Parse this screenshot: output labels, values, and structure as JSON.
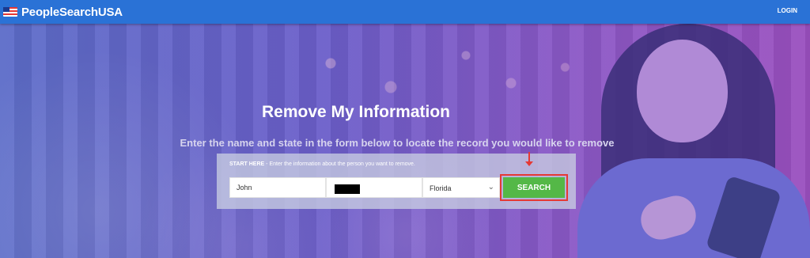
{
  "header": {
    "brand_name": "PeopleSearchUSA",
    "login_label": "LOGIN"
  },
  "hero": {
    "title": "Remove My Information",
    "subtitle": "Enter the name and state in the form below to locate the record you would like to remove"
  },
  "form": {
    "hint_label": "START HERE",
    "hint_text": " - Enter the information about the person you want to remove.",
    "first_name_value": "John",
    "state_value": "Florida",
    "search_label": "SEARCH"
  },
  "colors": {
    "header_bg": "#2a72d6",
    "search_button": "#54b847",
    "highlight": "#e53935"
  },
  "icons": [
    "flag-icon",
    "chevron-down-icon",
    "arrow-down-icon"
  ]
}
